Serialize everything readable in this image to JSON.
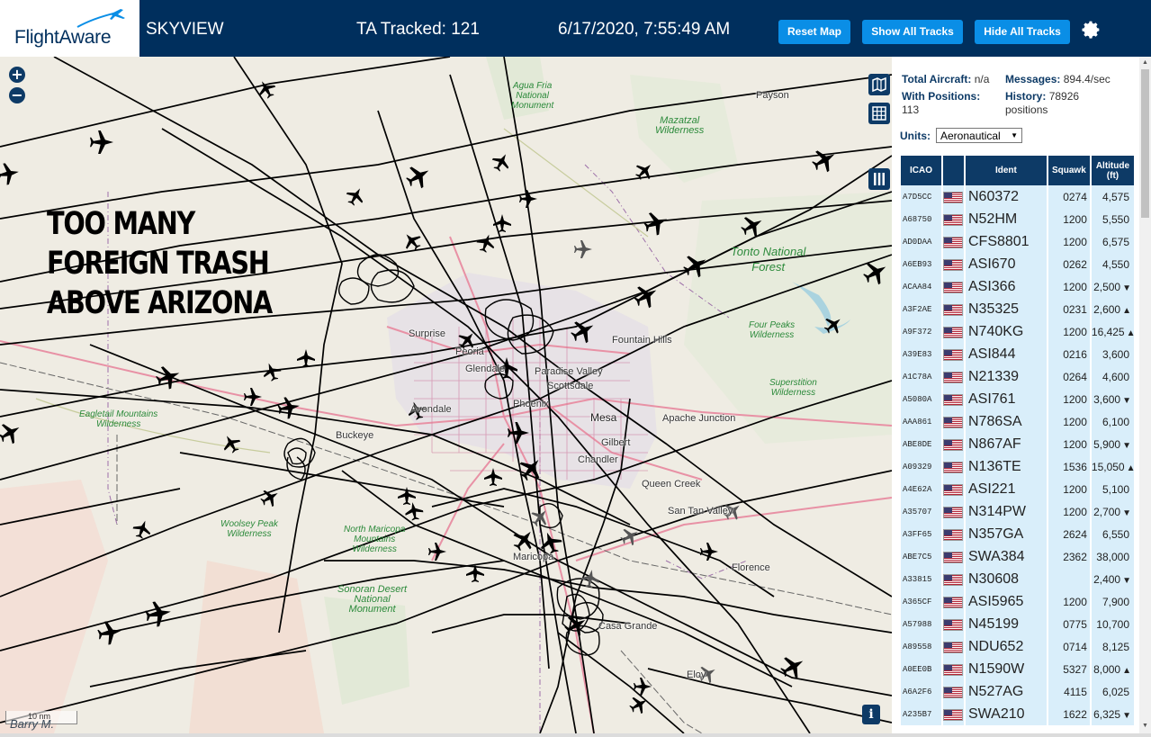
{
  "header": {
    "logo_text": "FlightAware",
    "site_name": "SKYVIEW",
    "tracked": "TA Tracked: 121",
    "clock": "6/17/2020, 7:55:49 AM",
    "buttons": {
      "reset": "Reset Map",
      "show": "Show All Tracks",
      "hide": "Hide All Tracks"
    },
    "settings_icon": "gear-icon",
    "colors": {
      "bar": "#002f5d",
      "button": "#0a8ee6"
    }
  },
  "map": {
    "overlay_text": [
      "TOO MANY",
      "FOREIGN TRASH",
      "ABOVE ARIZONA"
    ],
    "zoom_in": "+",
    "zoom_out": "−",
    "tools": [
      "map-layers-icon",
      "grid-icon",
      "columns-icon"
    ],
    "info": "i",
    "scale": "10 nm",
    "watermark": "Barry M.",
    "wilderness_labels": [
      "Agua Fria National Monument",
      "Mazatzal Wilderness",
      "Tonto National Forest",
      "Four Peaks Wilderness",
      "Superstition Wilderness",
      "Eagletail Mountains Wilderness",
      "Woolsey Peak Wilderness",
      "North Maricopa Mountains Wilderness",
      "Sonoran Desert National Monument"
    ],
    "cities": [
      "Payson",
      "Surprise",
      "Peoria",
      "Glendale",
      "Paradise Valley",
      "Scottsdale",
      "Fountain Hills",
      "Avondale",
      "Phoenix",
      "Mesa",
      "Apache Junction",
      "Buckeye",
      "Gilbert",
      "Chandler",
      "Queen Creek",
      "San Tan Valley",
      "Maricopa",
      "Florence",
      "Casa Grande",
      "Eloy"
    ]
  },
  "stats": {
    "total_label": "Total Aircraft:",
    "total_value": "n/a",
    "messages_label": "Messages:",
    "messages_value": "894.4/sec",
    "positions_label": "With Positions:",
    "positions_value": "113",
    "history_label": "History:",
    "history_value": "78926",
    "history_unit": "positions",
    "units_label": "Units:",
    "units_value": "Aeronautical"
  },
  "table": {
    "headers": {
      "icao": "ICAO",
      "ident": "Ident",
      "squawk": "Squawk",
      "alt_top": "Altitude",
      "alt_bottom": "(ft)"
    },
    "rows": [
      {
        "icao": "A7D5CC",
        "ident": "N60372",
        "squawk": "0274",
        "alt": "4,575",
        "trend": ""
      },
      {
        "icao": "A68750",
        "ident": "N52HM",
        "squawk": "1200",
        "alt": "5,550",
        "trend": ""
      },
      {
        "icao": "AD0DAA",
        "ident": "CFS8801",
        "squawk": "1200",
        "alt": "6,575",
        "trend": ""
      },
      {
        "icao": "A6EB93",
        "ident": "ASI670",
        "squawk": "0262",
        "alt": "4,550",
        "trend": ""
      },
      {
        "icao": "ACAA84",
        "ident": "ASI366",
        "squawk": "1200",
        "alt": "2,500",
        "trend": "▼"
      },
      {
        "icao": "A3F2AE",
        "ident": "N35325",
        "squawk": "0231",
        "alt": "2,600",
        "trend": "▲"
      },
      {
        "icao": "A9F372",
        "ident": "N740KG",
        "squawk": "1200",
        "alt": "16,425",
        "trend": "▲"
      },
      {
        "icao": "A39E83",
        "ident": "ASI844",
        "squawk": "0216",
        "alt": "3,600",
        "trend": ""
      },
      {
        "icao": "A1C78A",
        "ident": "N21339",
        "squawk": "0264",
        "alt": "4,600",
        "trend": ""
      },
      {
        "icao": "A5080A",
        "ident": "ASI761",
        "squawk": "1200",
        "alt": "3,600",
        "trend": "▼"
      },
      {
        "icao": "AAA861",
        "ident": "N786SA",
        "squawk": "1200",
        "alt": "6,100",
        "trend": ""
      },
      {
        "icao": "ABE8DE",
        "ident": "N867AF",
        "squawk": "1200",
        "alt": "5,900",
        "trend": "▼"
      },
      {
        "icao": "A09329",
        "ident": "N136TE",
        "squawk": "1536",
        "alt": "15,050",
        "trend": "▲"
      },
      {
        "icao": "A4E62A",
        "ident": "ASI221",
        "squawk": "1200",
        "alt": "5,100",
        "trend": ""
      },
      {
        "icao": "A35707",
        "ident": "N314PW",
        "squawk": "1200",
        "alt": "2,700",
        "trend": "▼"
      },
      {
        "icao": "A3FF65",
        "ident": "N357GA",
        "squawk": "2624",
        "alt": "6,550",
        "trend": ""
      },
      {
        "icao": "ABE7C5",
        "ident": "SWA384",
        "squawk": "2362",
        "alt": "38,000",
        "trend": ""
      },
      {
        "icao": "A33815",
        "ident": "N30608",
        "squawk": "",
        "alt": "2,400",
        "trend": "▼"
      },
      {
        "icao": "A365CF",
        "ident": "ASI5965",
        "squawk": "1200",
        "alt": "7,900",
        "trend": ""
      },
      {
        "icao": "A57988",
        "ident": "N45199",
        "squawk": "0775",
        "alt": "10,700",
        "trend": ""
      },
      {
        "icao": "A89558",
        "ident": "NDU652",
        "squawk": "0714",
        "alt": "8,125",
        "trend": ""
      },
      {
        "icao": "A0EE0B",
        "ident": "N1590W",
        "squawk": "5327",
        "alt": "8,000",
        "trend": "▲"
      },
      {
        "icao": "A6A2F6",
        "ident": "N527AG",
        "squawk": "4115",
        "alt": "6,025",
        "trend": ""
      },
      {
        "icao": "A235B7",
        "ident": "SWA210",
        "squawk": "1622",
        "alt": "6,325",
        "trend": "▼"
      }
    ]
  }
}
